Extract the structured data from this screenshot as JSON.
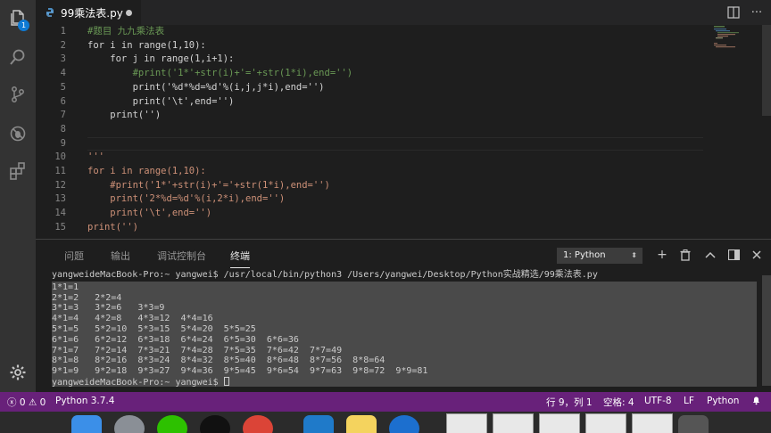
{
  "tab": {
    "filename": "99乘法表.py"
  },
  "explorer_badge": "1",
  "editor": {
    "line_numbers": [
      "1",
      "2",
      "3",
      "4",
      "5",
      "6",
      "7",
      "8",
      "9",
      "10",
      "11",
      "12",
      "13",
      "14",
      "15"
    ],
    "lines": [
      "#题目 九九乘法表",
      "for i in range(1,10):",
      "    for j in range(1,i+1):",
      "        #print('1*'+str(i)+'='+str(1*i),end='')",
      "        print('%d*%d=%d'%(i,j,j*i),end='')",
      "        print('\\t',end='')",
      "    print('')",
      "",
      "",
      "'''",
      "for i in range(1,10):",
      "    #print('1*'+str(i)+'='+str(1*i),end='')",
      "    print('2*%d=%d'%(i,2*i),end='')",
      "    print('\\t',end='')",
      "print('')"
    ]
  },
  "panel": {
    "tabs": [
      "问题",
      "输出",
      "调试控制台",
      "终端"
    ],
    "active_tab": "终端",
    "terminal_select": "1: Python",
    "terminal_lines": [
      "yangweideMacBook-Pro:~ yangwei$ /usr/local/bin/python3 /Users/yangwei/Desktop/Python实战精选/99乘法表.py",
      "1*1=1",
      "2*1=2   2*2=4",
      "3*1=3   3*2=6   3*3=9",
      "4*1=4   4*2=8   4*3=12  4*4=16",
      "5*1=5   5*2=10  5*3=15  5*4=20  5*5=25",
      "6*1=6   6*2=12  6*3=18  6*4=24  6*5=30  6*6=36",
      "7*1=7   7*2=14  7*3=21  7*4=28  7*5=35  7*6=42  7*7=49",
      "8*1=8   8*2=16  8*3=24  8*4=32  8*5=40  8*6=48  8*7=56  8*8=64",
      "9*1=9   9*2=18  9*3=27  9*4=36  9*5=45  9*6=54  9*7=63  9*8=72  9*9=81",
      "yangweideMacBook-Pro:~ yangwei$ "
    ]
  },
  "status": {
    "errors": "0",
    "warnings": "0",
    "interpreter": "Python 3.7.4",
    "position": "行 9，列 1",
    "indent": "空格: 4",
    "encoding": "UTF-8",
    "eol": "LF",
    "language": "Python"
  },
  "colors": {
    "status_bar": "#68217a",
    "activity_bar": "#333333",
    "editor_bg": "#1e1e1e"
  }
}
